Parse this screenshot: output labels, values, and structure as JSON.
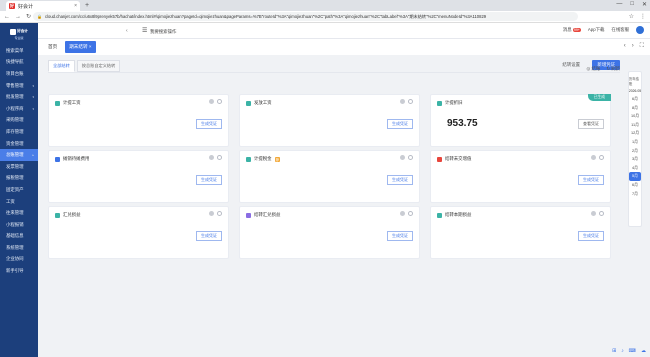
{
  "browser": {
    "tab_title": "好会计",
    "tab_close": "×",
    "new_tab": "+",
    "window_controls": [
      "—",
      "□",
      "✕"
    ],
    "url": "cloud.chanjet.com/cc/u6x8l9prenyek57b/hachat/index.html#/qimojiezhuan?pageId=qimojiezhuan&pageParams=%7B\"routeId\"%3A\"qimojiezhuan\"%2C\"path\"%3A\"qimojiezhuan\"%2C\"tabLabel\"%3A\"期末结转\"%2C\"menuNodeId\"%3A110829",
    "nav": [
      "←",
      "→",
      "↻"
    ],
    "addr_icons": [
      "☆",
      "⋮"
    ]
  },
  "sidebar": {
    "logo_text": "好会计",
    "logo_sub": "专业版",
    "items": [
      {
        "label": "搜索菜单",
        "caret": ""
      },
      {
        "label": "快捷导航",
        "caret": ""
      },
      {
        "label": "项目台账",
        "caret": ""
      },
      {
        "label": "零售管理",
        "caret": "▾"
      },
      {
        "label": "批发管理",
        "caret": "▾"
      },
      {
        "label": "小程序商",
        "caret": "▾"
      },
      {
        "label": "采购管理",
        "caret": ""
      },
      {
        "label": "库存管理",
        "caret": ""
      },
      {
        "label": "资金管理",
        "caret": ""
      },
      {
        "label": "总账管理",
        "caret": "▸"
      },
      {
        "label": "发票管理",
        "caret": ""
      },
      {
        "label": "报税管理",
        "caret": ""
      },
      {
        "label": "固定资产",
        "caret": ""
      },
      {
        "label": "工资",
        "caret": ""
      },
      {
        "label": "往来管理",
        "caret": ""
      },
      {
        "label": "小程报销",
        "caret": ""
      },
      {
        "label": "基础信息",
        "caret": ""
      },
      {
        "label": "系统管理",
        "caret": ""
      },
      {
        "label": "企业协同",
        "caret": ""
      },
      {
        "label": "新手引导",
        "caret": ""
      }
    ],
    "active_index": 9
  },
  "header": {
    "back": "‹",
    "menu_icon": "☰",
    "search_text": "我要搜索操作",
    "right": {
      "msg_label": "消息",
      "badge": "99+",
      "app_label": "App下载",
      "online_label": "在线客服"
    }
  },
  "page_tabs": {
    "home": "首页",
    "current": "期末结转 ×",
    "right_icons": [
      "‹",
      "›",
      "⛶"
    ]
  },
  "content": {
    "subtabs": [
      "全部结转",
      "按总账自定义结转"
    ],
    "primary_button": "新增凭证",
    "top_links": [
      "结转设置",
      "全部"
    ],
    "row2_links": [
      "◎ 结账",
      "↻ 刷新"
    ]
  },
  "cards": [
    {
      "title": "计提工资",
      "icon_color": "#3bb3a6",
      "button": "生成凭证",
      "value": "",
      "ribbon": "",
      "tag": ""
    },
    {
      "title": "发放工资",
      "icon_color": "#3bb3a6",
      "button": "生成凭证",
      "value": "",
      "ribbon": "",
      "tag": ""
    },
    {
      "title": "计提折旧",
      "icon_color": "#3bb3a6",
      "button": "查看凭证",
      "value": "953.75",
      "ribbon": "已生成",
      "tag": ""
    },
    {
      "title": "摊销待摊费用",
      "icon_color": "#3d73e6",
      "button": "生成凭证",
      "value": "",
      "ribbon": "",
      "tag": ""
    },
    {
      "title": "计提税金",
      "icon_color": "#3bb3a6",
      "button": "生成凭证",
      "value": "",
      "ribbon": "",
      "tag": "荐"
    },
    {
      "title": "结转未交增值",
      "icon_color": "#e8463c",
      "button": "生成凭证",
      "value": "",
      "ribbon": "",
      "tag": ""
    },
    {
      "title": "汇兑损益",
      "icon_color": "#3bb3a6",
      "button": "生成凭证",
      "value": "",
      "ribbon": "",
      "tag": ""
    },
    {
      "title": "结转汇兑损益",
      "icon_color": "#8a6de3",
      "button": "生成凭证",
      "value": "",
      "ribbon": "",
      "tag": ""
    },
    {
      "title": "结转本期损益",
      "icon_color": "#3bb3a6",
      "button": "生成凭证",
      "value": "",
      "ribbon": "",
      "tag": ""
    }
  ],
  "rail": {
    "title": "历年结账",
    "year": "2026.05",
    "months": [
      "6月",
      "8月",
      "10月",
      "11月",
      "12月",
      "1月",
      "2月",
      "3月",
      "4月",
      "5月",
      "6月",
      "7月"
    ],
    "active_index": 9,
    "up_icon": "▲"
  },
  "tray": [
    "⊞",
    "♪",
    "⌨",
    "☁"
  ],
  "colors": {
    "sidebar": "#1c3f7c",
    "accent": "#3d73e6",
    "active_side": "#4a7ee8"
  }
}
